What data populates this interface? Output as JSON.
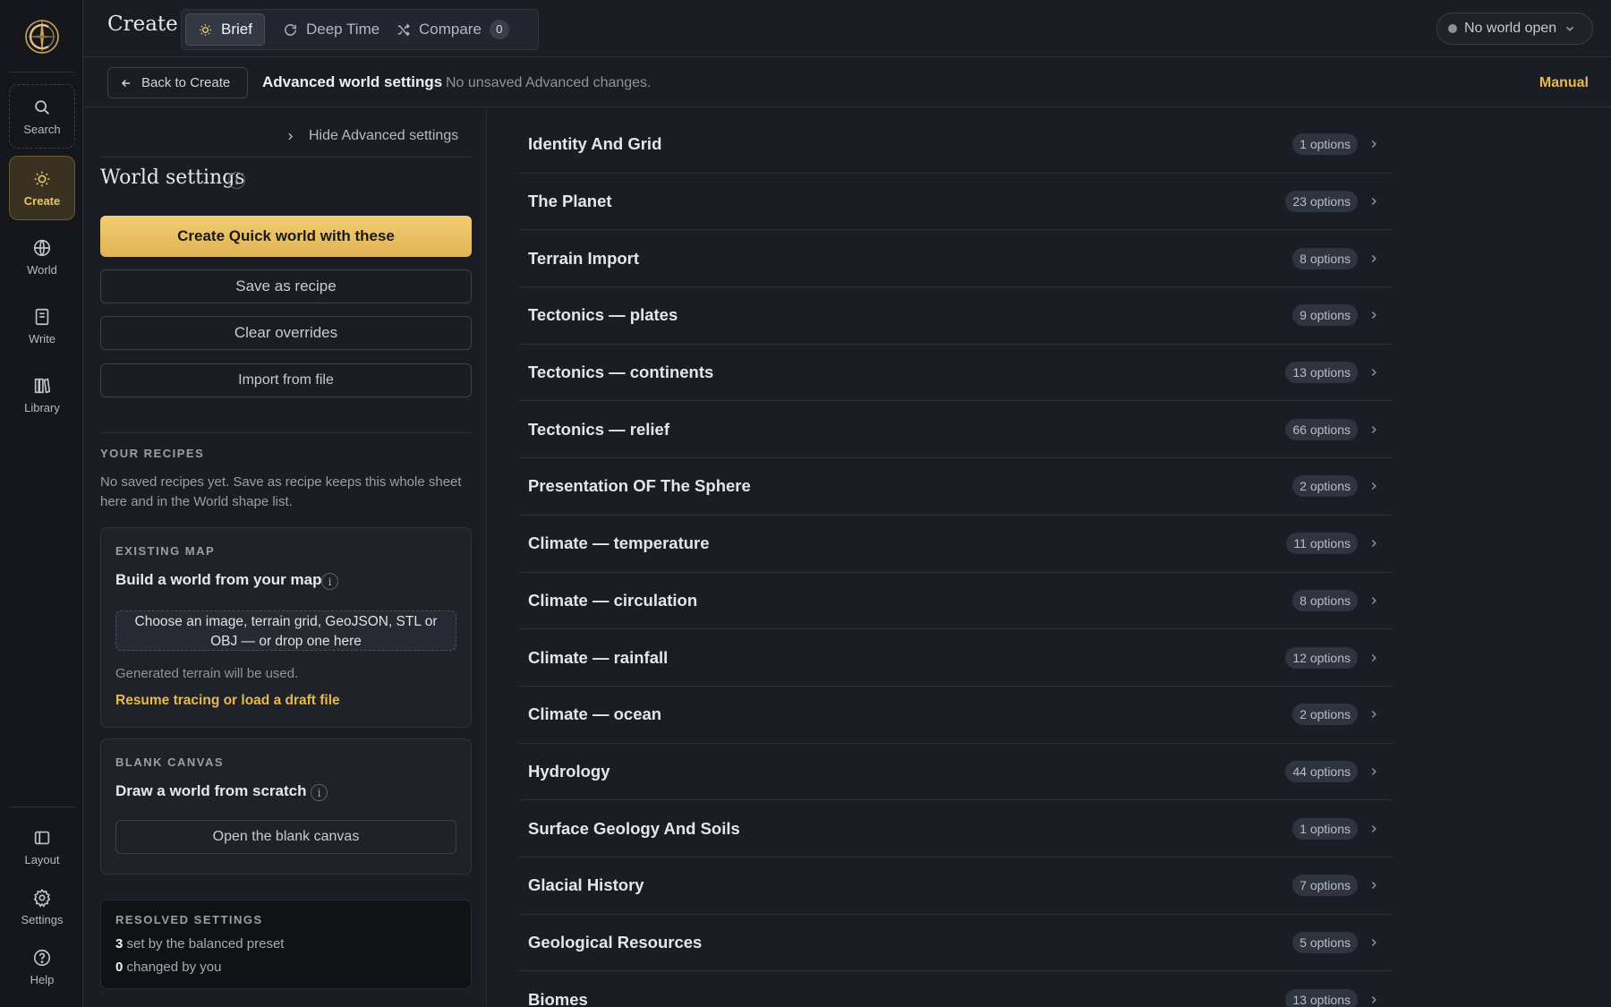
{
  "rail": {
    "items": [
      {
        "label": "Search",
        "icon": "search-icon"
      },
      {
        "label": "Create",
        "icon": "sun-icon"
      },
      {
        "label": "World",
        "icon": "globe-icon"
      },
      {
        "label": "Write",
        "icon": "notebook-icon"
      },
      {
        "label": "Library",
        "icon": "books-icon"
      }
    ],
    "bottom": [
      {
        "label": "Layout",
        "icon": "layout-icon"
      },
      {
        "label": "Settings",
        "icon": "gear-icon"
      },
      {
        "label": "Help",
        "icon": "help-icon"
      }
    ]
  },
  "topbar": {
    "title": "Create",
    "tabs": [
      {
        "label": "Brief",
        "icon": "sun-icon"
      },
      {
        "label": "Deep Time",
        "icon": "refresh-icon"
      },
      {
        "label": "Compare",
        "icon": "shuffle-icon",
        "count": "0"
      }
    ],
    "world_select": "No world open"
  },
  "subbar": {
    "back": "Back to Create",
    "title": "Advanced world settings",
    "status": "No unsaved Advanced changes.",
    "manual": "Manual"
  },
  "panel": {
    "hide_advanced": "Hide Advanced settings",
    "title": "World settings",
    "info": "i",
    "primary": "Create Quick world with these",
    "save_recipe": "Save as recipe",
    "clear": "Clear overrides",
    "import": "Import from file",
    "recipes_label": "YOUR RECIPES",
    "recipes_text": "No saved recipes yet. Save as recipe keeps this whole sheet here and in the World shape list.",
    "existing": {
      "label": "EXISTING MAP",
      "title": "Build a world from your map",
      "drop_line1": "Choose an image, terrain grid, GeoJSON, STL or",
      "drop_line2": "OBJ — or drop one here",
      "note": "Generated terrain will be used.",
      "link": "Resume tracing or load a draft file"
    },
    "blank": {
      "label": "BLANK CANVAS",
      "title": "Draw a world from scratch",
      "button": "Open the blank canvas"
    },
    "resolved": {
      "label": "RESOLVED SETTINGS",
      "preset_count": "3",
      "preset_text": "set by the balanced preset",
      "changed_count": "0",
      "changed_text": "changed by you"
    }
  },
  "categories": [
    {
      "name": "Identity And Grid",
      "count": "1 options"
    },
    {
      "name": "The Planet",
      "count": "23 options"
    },
    {
      "name": "Terrain Import",
      "count": "8 options"
    },
    {
      "name": "Tectonics — plates",
      "count": "9 options"
    },
    {
      "name": "Tectonics — continents",
      "count": "13 options"
    },
    {
      "name": "Tectonics — relief",
      "count": "66 options"
    },
    {
      "name": "Presentation OF The Sphere",
      "count": "2 options"
    },
    {
      "name": "Climate — temperature",
      "count": "11 options"
    },
    {
      "name": "Climate — circulation",
      "count": "8 options"
    },
    {
      "name": "Climate — rainfall",
      "count": "12 options"
    },
    {
      "name": "Climate — ocean",
      "count": "2 options"
    },
    {
      "name": "Hydrology",
      "count": "44 options"
    },
    {
      "name": "Surface Geology And Soils",
      "count": "1 options"
    },
    {
      "name": "Glacial History",
      "count": "7 options"
    },
    {
      "name": "Geological Resources",
      "count": "5 options"
    },
    {
      "name": "Biomes",
      "count": "13 options"
    }
  ]
}
